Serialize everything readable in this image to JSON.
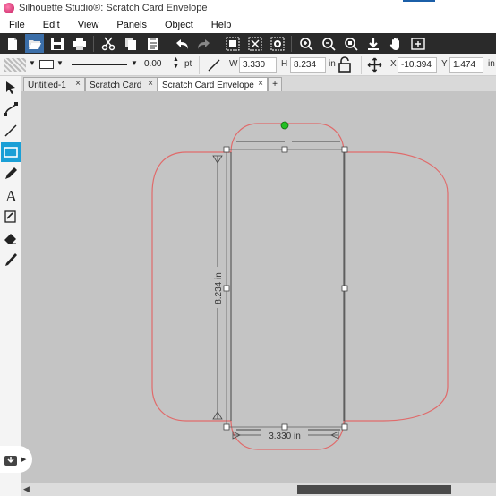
{
  "window": {
    "title": "Silhouette Studio®: Scratch Card Envelope"
  },
  "menu": {
    "items": [
      "File",
      "Edit",
      "View",
      "Panels",
      "Object",
      "Help"
    ]
  },
  "toolbar": {
    "icons": [
      "new-file-icon",
      "open-folder-icon",
      "save-icon",
      "print-icon",
      "cut-icon",
      "copy-icon",
      "paste-icon",
      "undo-icon",
      "redo-icon",
      "group-icon",
      "ungroup-icon",
      "compound-icon",
      "zoom-in-icon",
      "zoom-out-icon",
      "zoom-fit-icon",
      "zoom-selection-icon",
      "pan-hand-icon",
      "fit-page-icon"
    ]
  },
  "properties": {
    "line_width_value": "0.00",
    "line_width_unit": "pt",
    "width_label": "W",
    "width_value": "3.330",
    "height_label": "H",
    "height_value": "8.234",
    "size_unit": "in",
    "x_label": "X",
    "x_value": "-10.394",
    "y_label": "Y",
    "y_value": "1.474",
    "pos_unit": "in"
  },
  "tabs": [
    {
      "label": "Untitled-1",
      "active": false
    },
    {
      "label": "Scratch Card",
      "active": false
    },
    {
      "label": "Scratch Card Envelope",
      "active": true
    }
  ],
  "tab_close_glyph": "×",
  "tab_add_glyph": "+",
  "dimensions": {
    "height_label": "8.234 in",
    "width_label": "3.330 in"
  },
  "colors": {
    "cut_line": "#e06a6a",
    "selection": "#555555",
    "rotate_handle": "#22c022",
    "active_tool": "#1a9fd6"
  }
}
